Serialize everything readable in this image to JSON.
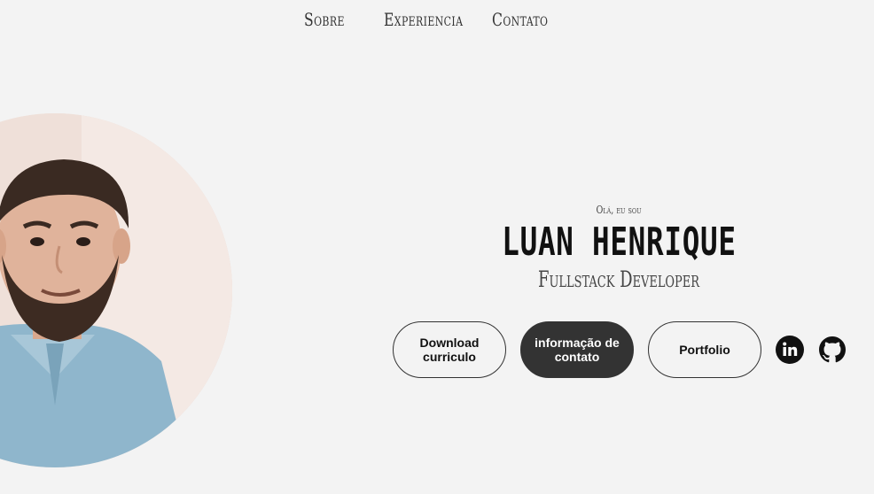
{
  "nav": {
    "items": [
      {
        "label": "Sobre"
      },
      {
        "label": "Experiencia"
      },
      {
        "label": "Contato"
      }
    ]
  },
  "hero": {
    "greeting": "Olá, eu sou",
    "name": "LUAN HENRIQUE",
    "role": "Fullstack Developer"
  },
  "actions": {
    "download_label": "Download curriculo",
    "contact_label": "informação de contato",
    "portfolio_label": "Portfolio"
  },
  "social": {
    "icons": [
      "linkedin-icon",
      "github-icon"
    ]
  },
  "colors": {
    "background": "#f3f3f3",
    "accent_dark": "#333333",
    "text": "#111111"
  }
}
